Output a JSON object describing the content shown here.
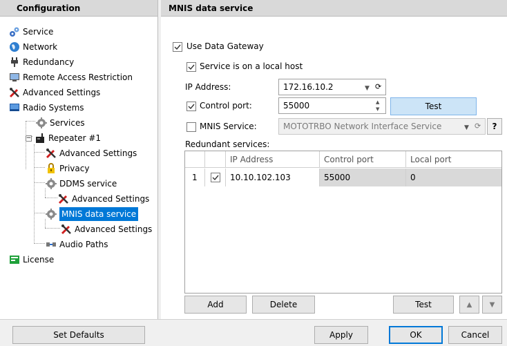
{
  "left_panel": {
    "title": "Configuration",
    "tree": [
      {
        "label": "Service",
        "icon": "gears-icon"
      },
      {
        "label": "Network",
        "icon": "globe-icon"
      },
      {
        "label": "Redundancy",
        "icon": "plug-icon"
      },
      {
        "label": "Remote Access Restriction",
        "icon": "remote-access-icon"
      },
      {
        "label": "Advanced Settings",
        "icon": "tools-icon"
      },
      {
        "label": "Radio Systems",
        "icon": "radio-systems-icon"
      },
      {
        "label": "Services",
        "icon": "gear-icon"
      },
      {
        "label": "Repeater #1",
        "icon": "repeater-icon"
      },
      {
        "label": "Advanced Settings",
        "icon": "tools-icon"
      },
      {
        "label": "Privacy",
        "icon": "lock-icon"
      },
      {
        "label": "DDMS service",
        "icon": "gear-icon"
      },
      {
        "label": "Advanced Settings",
        "icon": "tools-icon"
      },
      {
        "label": "MNIS data service",
        "icon": "gear-icon"
      },
      {
        "label": "Advanced Settings",
        "icon": "tools-icon"
      },
      {
        "label": "Audio Paths",
        "icon": "audio-path-icon"
      },
      {
        "label": "License",
        "icon": "license-icon"
      }
    ]
  },
  "right_panel": {
    "title": "MNIS data service",
    "use_gateway_label": "Use Data Gateway",
    "local_host_label": "Service is on a local host",
    "ip_label": "IP Address:",
    "ip_value": "172.16.10.2",
    "control_port_label": "Control port:",
    "control_port_value": "55000",
    "test_label": "Test",
    "mnis_service_label": "MNIS Service:",
    "mnis_service_value": "MOTOTRBO Network Interface Service",
    "help_label": "?",
    "redundant_label": "Redundant services:",
    "columns": [
      "IP Address",
      "Control port",
      "Local port"
    ],
    "rows": [
      {
        "index": "1",
        "ip": "10.10.102.103",
        "control_port": "55000",
        "local_port": "0"
      }
    ],
    "add_label": "Add",
    "delete_label": "Delete",
    "test_bottom_label": "Test"
  },
  "bottom_bar": {
    "set_defaults_label": "Set Defaults",
    "apply_label": "Apply",
    "ok_label": "OK",
    "cancel_label": "Cancel"
  },
  "colors": {
    "selection": "#0078d7",
    "header_bg": "#d9d9d9",
    "test_button_bg": "#cce4f7"
  }
}
